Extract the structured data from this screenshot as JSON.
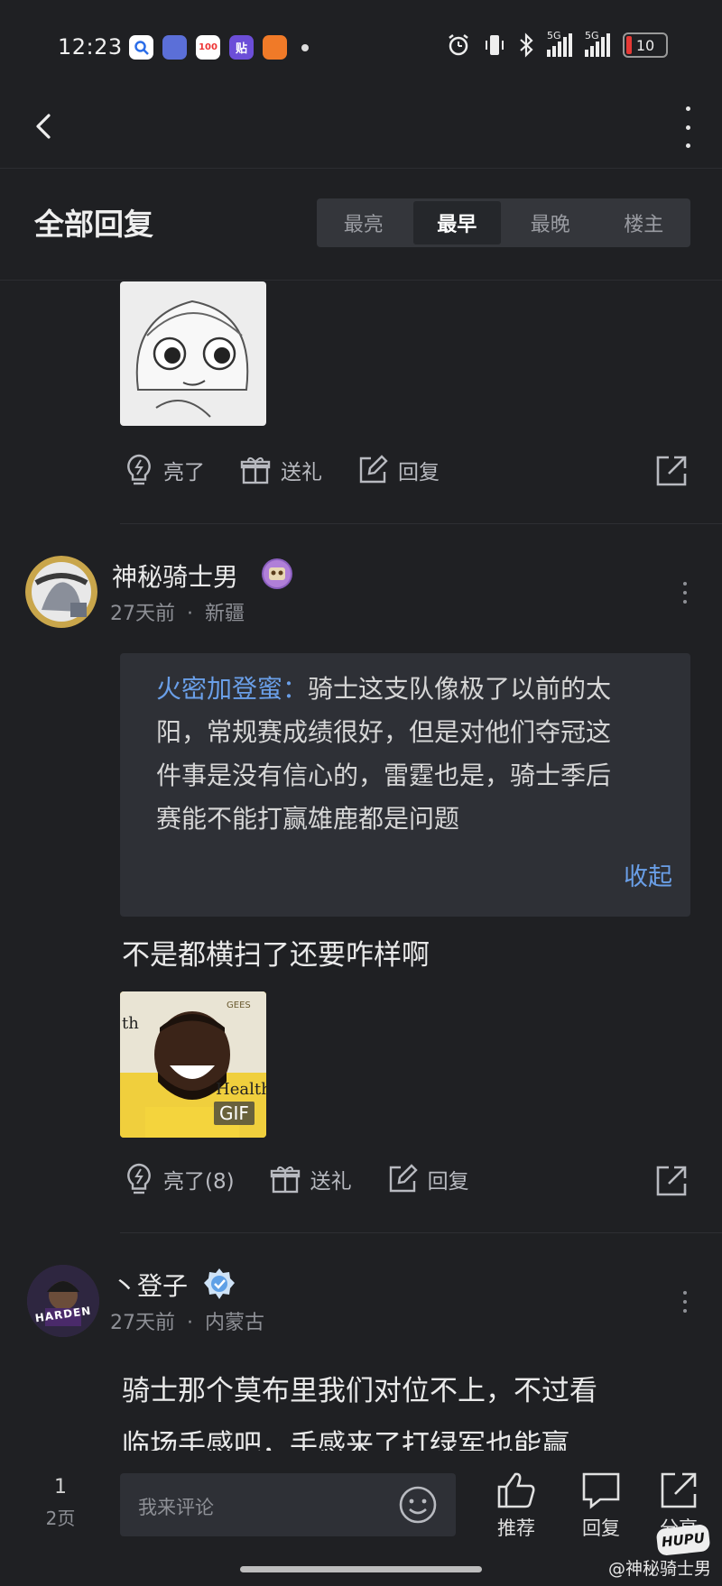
{
  "status_bar": {
    "time": "12:23",
    "network_1": "5G",
    "network_2": "5G",
    "battery": "10"
  },
  "header": {
    "title": "全部回复",
    "sort_tabs": [
      "最亮",
      "最早",
      "最晚",
      "楼主"
    ],
    "active_tab": "最早"
  },
  "post0": {
    "actions": {
      "like": "亮了",
      "gift": "送礼",
      "reply": "回复"
    }
  },
  "post1": {
    "username": "神秘骑士男",
    "time": "27天前",
    "location": "新疆",
    "quote": {
      "author": "火密加登蜜：",
      "lines": [
        "骑士这支队像极了以前的太",
        "阳，常规赛成绩很好，但是对他们夺冠这",
        "件事是没有信心的，雷霆也是，骑士季后",
        "赛能不能打赢雄鹿都是问题"
      ],
      "collapse": "收起"
    },
    "content": "不是都横扫了还要咋样啊",
    "gif_label": "GIF",
    "gif_text_1": "th",
    "gif_text_2": "Health",
    "gif_text_3": "GEES",
    "actions": {
      "like": "亮了(8)",
      "gift": "送礼",
      "reply": "回复"
    }
  },
  "post2": {
    "username": "丶登子",
    "time": "27天前",
    "location": "内蒙古",
    "avatar_text": "HARDEN",
    "content_lines": [
      "骑士那个莫布里我们对位不上，不过看",
      "临场手感吧，手感来了打绿军也能赢"
    ]
  },
  "bottom_bar": {
    "page_current": "1",
    "page_total": "2页",
    "comment_placeholder": "我来评论",
    "recommend": "推荐",
    "reply": "回复",
    "share": "分享"
  },
  "watermark": "@神秘骑士男",
  "hupu_logo": "HUPU",
  "colors": {
    "background": "#1f2023",
    "accent_blue": "#6a9fe8",
    "quote_bg": "#2e3036",
    "battery_red": "#e53935"
  },
  "icons": [
    "back-arrow-icon",
    "more-vertical-icon",
    "lightbulb-icon",
    "gift-icon",
    "edit-icon",
    "share-external-icon",
    "thumbs-up-icon",
    "comment-bubble-icon",
    "emoji-icon"
  ]
}
